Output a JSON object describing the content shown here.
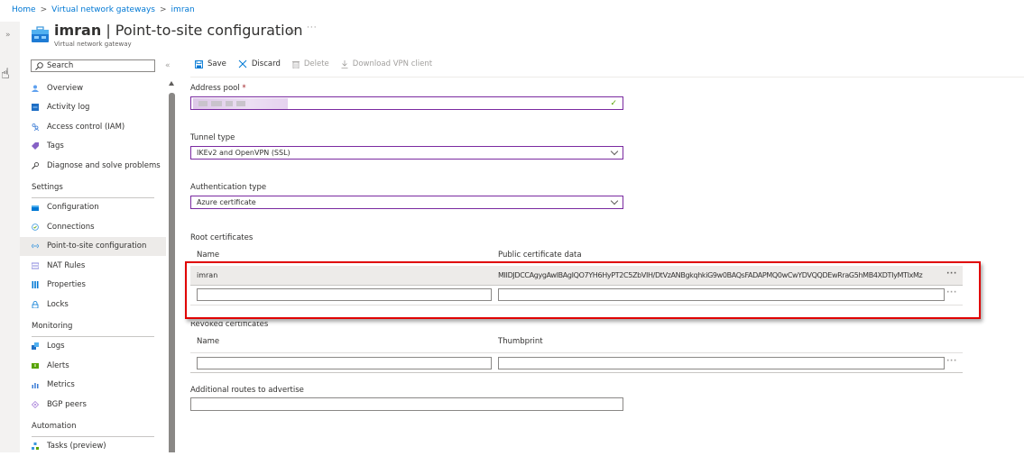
{
  "breadcrumb": [
    {
      "label": "Home"
    },
    {
      "label": "Virtual network gateways"
    },
    {
      "label": "imran"
    }
  ],
  "breadcrumb_separator": ">",
  "header": {
    "resource_name": "imran",
    "separator": " | ",
    "page_title": "Point-to-site configuration",
    "subtitle": "Virtual network gateway",
    "favorite_icon": "star-outline-icon",
    "more_label": "···"
  },
  "rail": {
    "expand_label": "»"
  },
  "sidebar": {
    "search_placeholder": "Search",
    "collapse_label": "«",
    "items_top": [
      {
        "label": "Overview",
        "icon": "overview-icon",
        "color": "#5ea0ef"
      },
      {
        "label": "Activity log",
        "icon": "activity-log-icon",
        "color": "#1f6fc5"
      },
      {
        "label": "Access control (IAM)",
        "icon": "iam-icon",
        "color": "#3a7bd5"
      },
      {
        "label": "Tags",
        "icon": "tag-icon",
        "color": "#8661c5"
      },
      {
        "label": "Diagnose and solve problems",
        "icon": "wrench-icon",
        "color": "#323130"
      }
    ],
    "sections": [
      {
        "title": "Settings",
        "items": [
          {
            "label": "Configuration",
            "icon": "configuration-icon",
            "color": "#0078d4"
          },
          {
            "label": "Connections",
            "icon": "connections-icon",
            "color": "#3a96dd"
          },
          {
            "label": "Point-to-site configuration",
            "icon": "point-to-site-icon",
            "color": "#50a0e0",
            "active": true
          },
          {
            "label": "NAT Rules",
            "icon": "nat-rules-icon",
            "color": "#6b69d6"
          },
          {
            "label": "Properties",
            "icon": "properties-icon",
            "color": "#0078d4"
          },
          {
            "label": "Locks",
            "icon": "lock-icon",
            "color": "#0078d4"
          }
        ]
      },
      {
        "title": "Monitoring",
        "items": [
          {
            "label": "Logs",
            "icon": "logs-icon",
            "color": "#1f6fc5"
          },
          {
            "label": "Alerts",
            "icon": "alerts-icon",
            "color": "#57a300"
          },
          {
            "label": "Metrics",
            "icon": "metrics-icon",
            "color": "#3a7bd5"
          },
          {
            "label": "BGP peers",
            "icon": "bgp-peers-icon",
            "color": "#a77fd8"
          }
        ]
      },
      {
        "title": "Automation",
        "items": [
          {
            "label": "Tasks (preview)",
            "icon": "tasks-icon",
            "color": "#3a96dd"
          }
        ]
      }
    ]
  },
  "toolbar": {
    "save_label": "Save",
    "discard_label": "Discard",
    "delete_label": "Delete",
    "download_label": "Download VPN client"
  },
  "form": {
    "address_pool": {
      "label": "Address pool",
      "required_mark": "*",
      "value": "(redacted)",
      "valid": true
    },
    "tunnel_type": {
      "label": "Tunnel type",
      "value": "IKEv2 and OpenVPN (SSL)"
    },
    "authentication_type": {
      "label": "Authentication type",
      "value": "Azure certificate"
    },
    "root_certificates": {
      "label": "Root certificates",
      "columns": [
        "Name",
        "Public certificate data"
      ],
      "rows": [
        {
          "name": "imran",
          "data": "MIIDJDCCAgygAwIBAgIQO7YH6HyPT2C5ZbVIH/DtVzANBgkqhkiG9w0BAQsFADAPMQ0wCwYDVQQDEwRraG5hMB4XDTIyMTIxMz"
        }
      ],
      "more_label": "···"
    },
    "revoked_certificates": {
      "label": "Revoked certificates",
      "columns": [
        "Name",
        "Thumbprint"
      ],
      "more_label": "···"
    },
    "additional_routes": {
      "label": "Additional routes to advertise",
      "value": ""
    }
  },
  "colors": {
    "accent": "#0078d4",
    "field_border_active": "#7a2aa0",
    "highlight_annotation": "#e00000",
    "valid_check": "#57a300"
  }
}
